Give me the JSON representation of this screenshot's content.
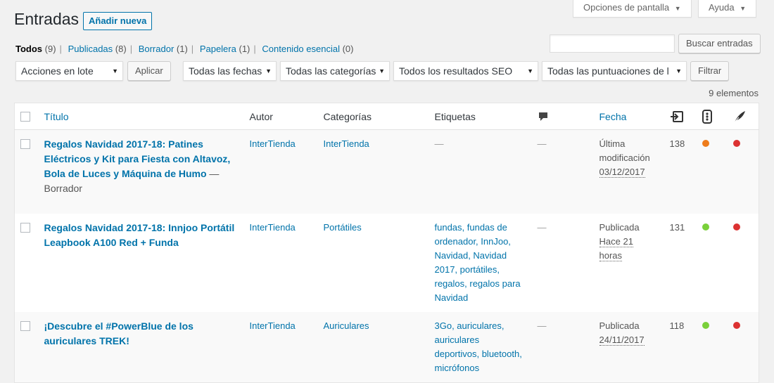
{
  "header": {
    "screen_options": "Opciones de pantalla",
    "help": "Ayuda",
    "title": "Entradas",
    "add_new": "Añadir nueva"
  },
  "views": [
    {
      "label": "Todos",
      "count": "(9)",
      "current": true
    },
    {
      "label": "Publicadas",
      "count": "(8)"
    },
    {
      "label": "Borrador",
      "count": "(1)"
    },
    {
      "label": "Papelera",
      "count": "(1)"
    },
    {
      "label": "Contenido esencial",
      "count": "(0)"
    }
  ],
  "search": {
    "button": "Buscar entradas",
    "value": ""
  },
  "filters": {
    "bulk_actions": "Acciones en lote",
    "apply": "Aplicar",
    "dates": "Todas las fechas",
    "categories": "Todas las categorías",
    "seo_results": "Todos los resultados SEO",
    "readability": "Todas las puntuaciones de l",
    "filter": "Filtrar"
  },
  "items_count": "9 elementos",
  "columns": {
    "title": "Título",
    "author": "Autor",
    "categories": "Categorías",
    "tags": "Etiquetas",
    "comments_icon": "comment-bubble-icon",
    "date": "Fecha",
    "links_icon": "internal-links-icon",
    "seo_icon": "seo-score-icon",
    "readability_icon": "readability-quill-icon"
  },
  "colors": {
    "link": "#0073aa",
    "orange": "#ee7c1b",
    "green": "#7ad03a",
    "red": "#dc3232"
  },
  "rows": [
    {
      "title": "Regalos Navidad 2017-18: Patines Eléctricos y Kit para Fiesta con Altavoz, Bola de Luces y Máquina de Humo",
      "state": "Borrador",
      "author": "InterTienda",
      "categories": "InterTienda",
      "tags": "—",
      "comments": "—",
      "date_status": "Última modificación",
      "date_value": "03/12/2017",
      "links": "138",
      "seo_color": "#ee7c1b",
      "read_color": "#dc3232"
    },
    {
      "title": "Regalos Navidad 2017-18: Innjoo Portátil Leapbook A100 Red + Funda",
      "state": "",
      "author": "InterTienda",
      "categories": "Portátiles",
      "tags": "fundas, fundas de ordenador, InnJoo, Navidad, Navidad 2017, portátiles, regalos, regalos para Navidad",
      "comments": "—",
      "date_status": "Publicada",
      "date_value": "Hace 21 horas",
      "links": "131",
      "seo_color": "#7ad03a",
      "read_color": "#dc3232"
    },
    {
      "title": "¡Descubre el #PowerBlue de los auriculares TREK!",
      "state": "",
      "author": "InterTienda",
      "categories": "Auriculares",
      "tags": "3Go, auriculares, auriculares deportivos, bluetooth, micrófonos",
      "comments": "—",
      "date_status": "Publicada",
      "date_value": "24/11/2017",
      "links": "118",
      "seo_color": "#7ad03a",
      "read_color": "#dc3232"
    }
  ]
}
